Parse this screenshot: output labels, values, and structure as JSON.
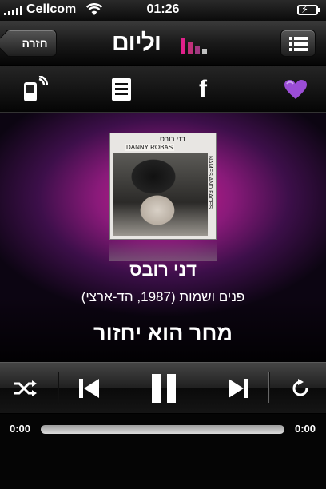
{
  "status_bar": {
    "carrier": "Cellcom",
    "time": "01:26",
    "signal_bars": 5,
    "battery_state": "charging"
  },
  "nav": {
    "back_label": "חזרה",
    "logo_text": "וליום",
    "logo_color": "#e0208a"
  },
  "toolbar": {
    "items": [
      {
        "name": "ringtone-phone-icon"
      },
      {
        "name": "lyrics-icon"
      },
      {
        "name": "facebook-icon",
        "glyph": "f"
      },
      {
        "name": "favorite-heart-icon",
        "color": "#9b4dd6"
      }
    ]
  },
  "now_playing": {
    "artist": "דני רובס",
    "album": "(פנים ושמות (1987, הד-ארצי",
    "song": "מחר הוא יחזור",
    "cover_text_en": "DANNY ROBAS",
    "cover_text_he": "דני רובס",
    "cover_side_text": "NAMES AND FACES"
  },
  "controls": {
    "shuffle": "shuffle-icon",
    "previous": "previous-track-icon",
    "play_state": "pause-icon",
    "next": "next-track-icon",
    "repeat": "repeat-icon"
  },
  "progress": {
    "elapsed": "0:00",
    "remaining": "0:00",
    "fraction": 0.0
  },
  "colors": {
    "accent": "#d21b8e",
    "heart": "#9b4dd6"
  }
}
